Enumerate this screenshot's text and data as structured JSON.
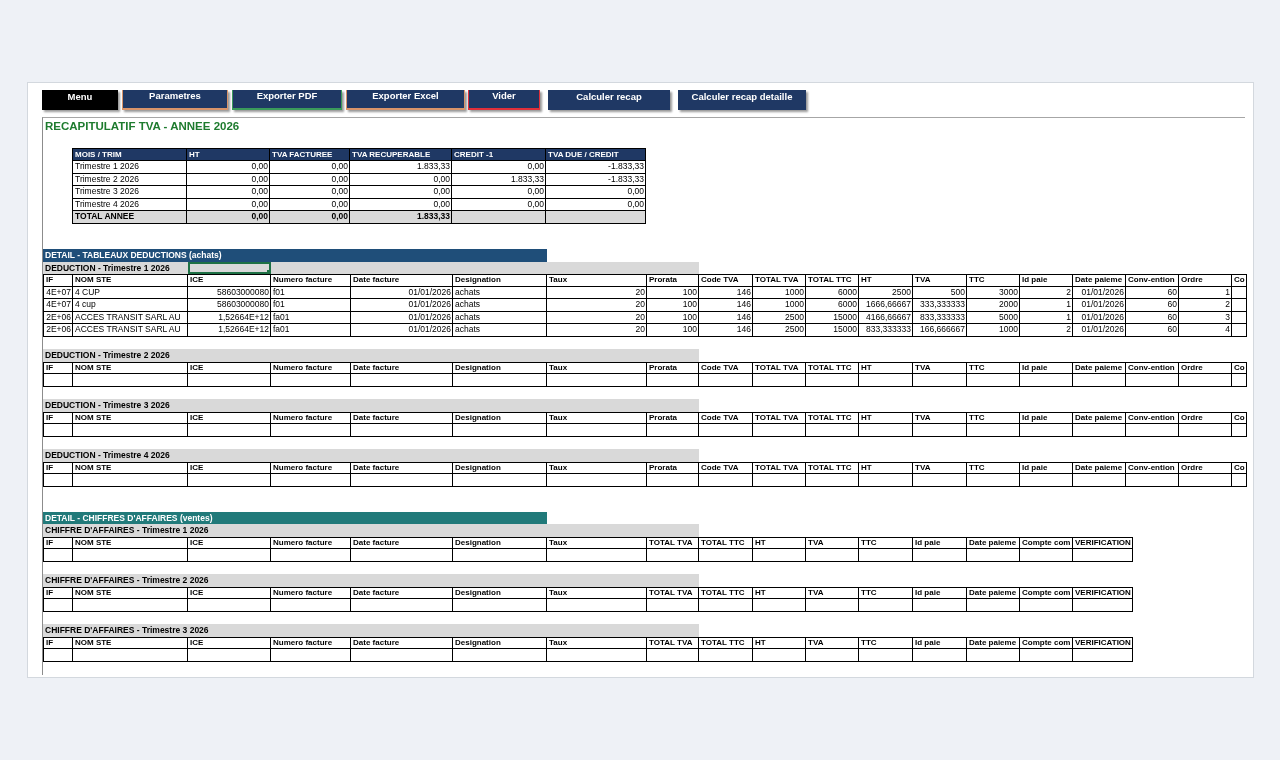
{
  "toolbar": {
    "buttons": [
      {
        "label": "Menu",
        "color": "#000000"
      },
      {
        "label": "Parametres",
        "color": "#1f3864",
        "accent": {
          "color": "#d9946a"
        }
      },
      {
        "label": "Exporter PDF",
        "color": "#1f3864",
        "accent": {
          "color": "#3a9a5b"
        }
      },
      {
        "label": "Exporter Excel",
        "color": "#1f3864",
        "accent": {
          "color": "#d9946a"
        }
      },
      {
        "label": "Vider",
        "color": "#1f3864",
        "accent": {
          "color": "#e0303a"
        }
      },
      {
        "label": "Calculer recap",
        "color": "#1f3864"
      },
      {
        "label": "Calculer recap detaille",
        "color": "#1f3864"
      }
    ]
  },
  "summary": {
    "title": "RECAPITULATIF TVA - ANNEE 2026",
    "columns": [
      "MOIS / TRIM",
      "HT",
      "TVA FACTUREE",
      "TVA RECUPERABLE",
      "CREDIT -1",
      "TVA DUE / CREDIT"
    ],
    "rows": [
      [
        "Trimestre 1 2026",
        "0,00",
        "0,00",
        "1.833,33",
        "0,00",
        "-1.833,33"
      ],
      [
        "Trimestre 2 2026",
        "0,00",
        "0,00",
        "0,00",
        "1.833,33",
        "-1.833,33"
      ],
      [
        "Trimestre 3 2026",
        "0,00",
        "0,00",
        "0,00",
        "0,00",
        "0,00"
      ],
      [
        "Trimestre 4 2026",
        "0,00",
        "0,00",
        "0,00",
        "0,00",
        "0,00"
      ]
    ],
    "total": [
      "TOTAL ANNEE",
      "0,00",
      "0,00",
      "1.833,33"
    ]
  },
  "sections": [
    {
      "title": "DETAIL - TABLEAUX DEDUCTIONS (achats)",
      "color": "#1f4e79",
      "tables": [
        {
          "title": "DEDUCTION - Trimestre 1 2026",
          "active_cell": true,
          "columns": [
            "IF",
            "NOM STE",
            "ICE",
            "Numero facture",
            "Date facture",
            "Designation",
            "Taux",
            "Prorata",
            "Code TVA",
            "TOTAL TVA",
            "TOTAL TTC",
            "HT",
            "TVA",
            "TTC",
            "Id paie",
            "Date paieme",
            "Conv-ention",
            "Ordre",
            "Co"
          ],
          "rows": [
            [
              "4E+07",
              "4 CUP",
              "58603000080",
              "f01",
              "01/01/2026",
              "achats",
              "20",
              "100",
              "146",
              "1000",
              "6000",
              "2500",
              "500",
              "3000",
              "2",
              "01/01/2026",
              "60",
              "1"
            ],
            [
              "4E+07",
              "4 cup",
              "58603000080",
              "f01",
              "01/01/2026",
              "achats",
              "20",
              "100",
              "146",
              "1000",
              "6000",
              "1666,66667",
              "333,333333",
              "2000",
              "1",
              "01/01/2026",
              "60",
              "2"
            ],
            [
              "2E+06",
              "ACCES TRANSIT SARL AU",
              "1,52664E+12",
              "fa01",
              "01/01/2026",
              "achats",
              "20",
              "100",
              "146",
              "2500",
              "15000",
              "4166,66667",
              "833,333333",
              "5000",
              "1",
              "01/01/2026",
              "60",
              "3"
            ],
            [
              "2E+06",
              "ACCES TRANSIT SARL AU",
              "1,52664E+12",
              "fa01",
              "01/01/2026",
              "achats",
              "20",
              "100",
              "146",
              "2500",
              "15000",
              "833,333333",
              "166,666667",
              "1000",
              "2",
              "01/01/2026",
              "60",
              "4"
            ]
          ]
        },
        {
          "title": "DEDUCTION - Trimestre 2 2026",
          "active_cell": false,
          "columns": [
            "IF",
            "NOM STE",
            "ICE",
            "Numero facture",
            "Date facture",
            "Designation",
            "Taux",
            "Prorata",
            "Code TVA",
            "TOTAL TVA",
            "TOTAL TTC",
            "HT",
            "TVA",
            "TTC",
            "Id paie",
            "Date paieme",
            "Conv-ention",
            "Ordre",
            "Co"
          ]
        },
        {
          "title": "DEDUCTION - Trimestre 3 2026",
          "active_cell": false,
          "columns": [
            "IF",
            "NOM STE",
            "ICE",
            "Numero facture",
            "Date facture",
            "Designation",
            "Taux",
            "Prorata",
            "Code TVA",
            "TOTAL TVA",
            "TOTAL TTC",
            "HT",
            "TVA",
            "TTC",
            "Id paie",
            "Date paieme",
            "Conv-ention",
            "Ordre",
            "Co"
          ]
        },
        {
          "title": "DEDUCTION - Trimestre 4 2026",
          "active_cell": false,
          "columns": [
            "IF",
            "NOM STE",
            "ICE",
            "Numero facture",
            "Date facture",
            "Designation",
            "Taux",
            "Prorata",
            "Code TVA",
            "TOTAL TVA",
            "TOTAL TTC",
            "HT",
            "TVA",
            "TTC",
            "Id paie",
            "Date paieme",
            "Conv-ention",
            "Ordre",
            "Co"
          ]
        }
      ]
    },
    {
      "title": "DETAIL - CHIFFRES D'AFFAIRES (ventes)",
      "color": "#217a7a",
      "tables": [
        {
          "title": "CHIFFRE D'AFFAIRES - Trimestre 1 2026",
          "active_cell": false,
          "columns": [
            "IF",
            "NOM STE",
            "ICE",
            "Numero facture",
            "Date facture",
            "Designation",
            "Taux",
            "TOTAL TVA",
            "TOTAL TTC",
            "HT",
            "TVA",
            "TTC",
            "Id paie",
            "Date paieme",
            "Compte com",
            "VERIFICATION"
          ]
        },
        {
          "title": "CHIFFRE D'AFFAIRES - Trimestre 2 2026",
          "active_cell": false,
          "columns": [
            "IF",
            "NOM STE",
            "ICE",
            "Numero facture",
            "Date facture",
            "Designation",
            "Taux",
            "TOTAL TVA",
            "TOTAL TTC",
            "HT",
            "TVA",
            "TTC",
            "Id paie",
            "Date paieme",
            "Compte com",
            "VERIFICATION"
          ]
        },
        {
          "title": "CHIFFRE D'AFFAIRES - Trimestre 3 2026",
          "active_cell": false,
          "columns": [
            "IF",
            "NOM STE",
            "ICE",
            "Numero facture",
            "Date facture",
            "Designation",
            "Taux",
            "TOTAL TVA",
            "TOTAL TTC",
            "HT",
            "TVA",
            "TTC",
            "Id paie",
            "Date paieme",
            "Compte com",
            "VERIFICATION"
          ]
        }
      ]
    }
  ]
}
